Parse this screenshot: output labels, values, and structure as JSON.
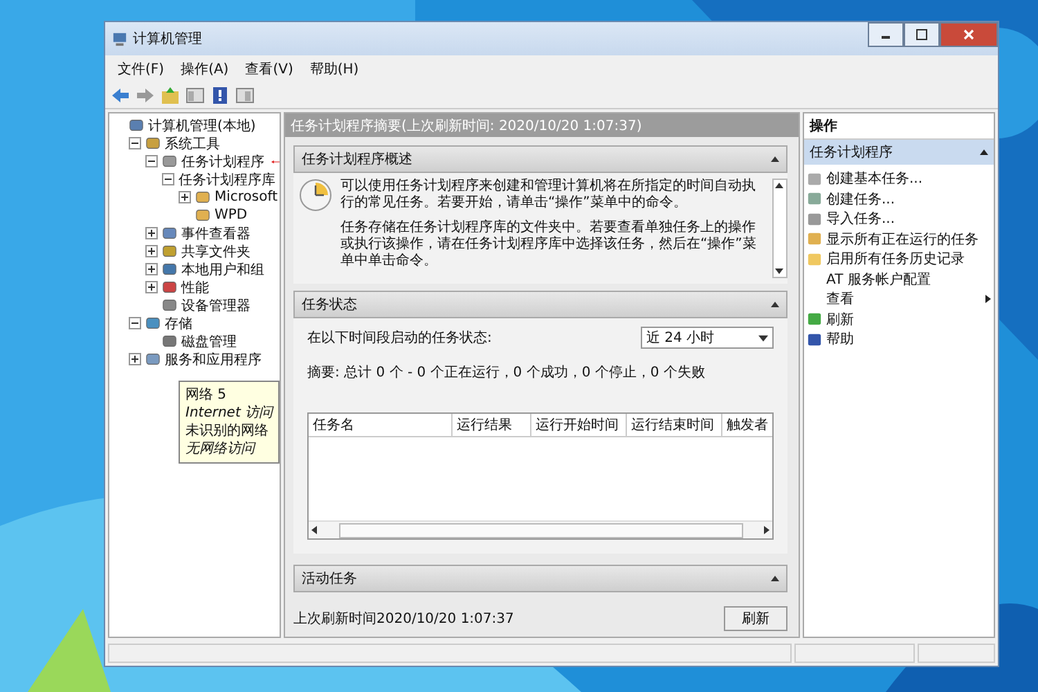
{
  "window": {
    "title": "计算机管理"
  },
  "menu": [
    "文件(F)",
    "操作(A)",
    "查看(V)",
    "帮助(H)"
  ],
  "tree": [
    {
      "label": "计算机管理(本地)",
      "children": [
        {
          "label": "系统工具",
          "expanded": true,
          "children": [
            {
              "label": "任务计划程序",
              "expanded": true,
              "pointed": true,
              "children": [
                {
                  "label": "任务计划程序库",
                  "expanded": true,
                  "children": [
                    {
                      "label": "Microsoft",
                      "expanded": false
                    },
                    {
                      "label": "WPD"
                    }
                  ]
                }
              ]
            },
            {
              "label": "事件查看器",
              "expanded": false
            },
            {
              "label": "共享文件夹",
              "expanded": false
            },
            {
              "label": "本地用户和组",
              "expanded": false
            },
            {
              "label": "性能",
              "expanded": false
            },
            {
              "label": "设备管理器"
            }
          ]
        },
        {
          "label": "存储",
          "expanded": true,
          "children": [
            {
              "label": "磁盘管理"
            }
          ]
        },
        {
          "label": "服务和应用程序",
          "expanded": false
        }
      ]
    }
  ],
  "tooltip": [
    {
      "text": "网络  5",
      "italic": false
    },
    {
      "text": "Internet 访问",
      "italic": true
    },
    {
      "text": "未识别的网络",
      "italic": false
    },
    {
      "text": "无网络访问",
      "italic": true
    }
  ],
  "summary_header": "任务计划程序摘要(上次刷新时间: 2020/10/20 1:07:37)",
  "overview": {
    "title": "任务计划程序概述",
    "paragraphs": [
      "可以使用任务计划程序来创建和管理计算机将在所指定的时间自动执行的常见任务。若要开始，请单击“操作”菜单中的命令。",
      "任务存储在任务计划程序库的文件夹中。若要查看单独任务上的操作或执行该操作，请在任务计划程序库中选择该任务，然后在“操作”菜单中单击命令。"
    ]
  },
  "task_status": {
    "title": "任务状态",
    "period_label": "在以下时间段启动的任务状态:",
    "period": "近 24 小时",
    "summary": "摘要: 总计 0 个 - 0 个正在运行，0 个成功，0 个停止，0 个失败",
    "columns": [
      "任务名",
      "运行结果",
      "运行开始时间",
      "运行结束时间",
      "触发者"
    ]
  },
  "active_tasks": {
    "title": "活动任务"
  },
  "last_refresh": "上次刷新时间2020/10/20 1:07:37",
  "refresh_button": "刷新",
  "actions": {
    "title": "操作",
    "section": "任务计划程序",
    "items": [
      {
        "label": "创建基本任务...",
        "submenu": false
      },
      {
        "label": "创建任务...",
        "submenu": false
      },
      {
        "label": "导入任务...",
        "submenu": false
      },
      {
        "label": "显示所有正在运行的任务",
        "submenu": false
      },
      {
        "label": "启用所有任务历史记录",
        "submenu": false
      },
      {
        "label": "AT 服务帐户配置",
        "submenu": false
      },
      {
        "label": "查看",
        "submenu": true
      },
      {
        "label": "刷新",
        "submenu": false
      },
      {
        "label": "帮助",
        "submenu": false
      }
    ]
  }
}
